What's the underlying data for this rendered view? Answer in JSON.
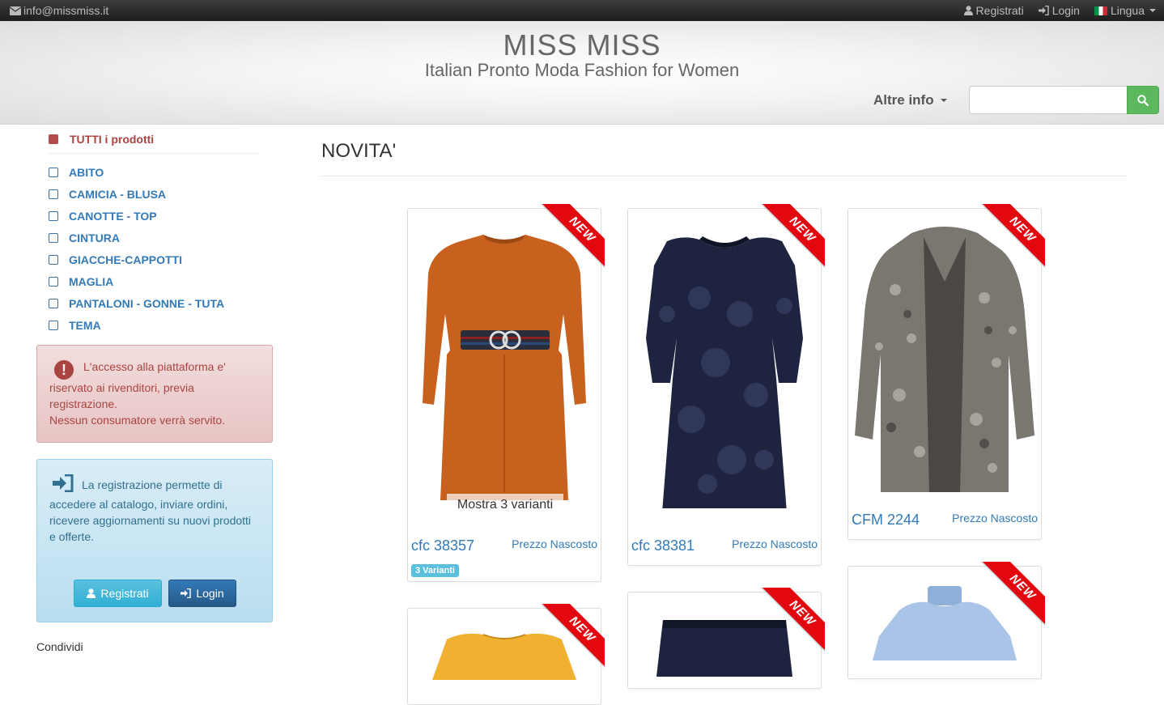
{
  "topbar": {
    "email": "info@missmiss.it",
    "register": "Registrati",
    "login": "Login",
    "language": "Lingua"
  },
  "header": {
    "brand": "MISS MISS",
    "tagline": "Italian Pronto Moda Fashion for Women",
    "more_info": "Altre info",
    "search_placeholder": ""
  },
  "sidebar": {
    "all_products": "TUTTI i prodotti",
    "categories": [
      "ABITO",
      "CAMICIA - BLUSA",
      "CANOTTE - TOP",
      "CINTURA",
      "GIACCHE-CAPPOTTI",
      "MAGLIA",
      "PANTALONI - GONNE - TUTA",
      "TEMA"
    ],
    "alert_danger": {
      "line1": "L'accesso alla piattaforma e' riservato ai rivenditori, previa registrazione.",
      "line2": "Nessun consumatore verrà servito."
    },
    "alert_info": {
      "text": "La registrazione permette di accedere al catalogo, inviare ordini, ricevere aggiornamenti su nuovi prodotti e offerte.",
      "register_button": "Registrati",
      "login_button": "Login"
    },
    "share": "Condividi"
  },
  "main": {
    "title": "NOVITA'",
    "ribbon_label": "NEW",
    "products": [
      {
        "code": "cfc 38357",
        "price": "Prezzo Nascosto",
        "variants_overlay": "Mostra 3 varianti",
        "variants_badge": "3 Varianti",
        "color": "#c8601e"
      },
      {
        "code": "cfc 38381",
        "price": "Prezzo Nascosto",
        "color": "#1e2440"
      },
      {
        "code": "CFM 2244",
        "price": "Prezzo Nascosto",
        "color": "#7a7670"
      },
      {
        "code": "",
        "price": "",
        "color": "#f0b030"
      },
      {
        "code": "",
        "price": "",
        "color": "#1e2440"
      },
      {
        "code": "",
        "price": "",
        "color": "#a9c4e6"
      }
    ]
  },
  "colors": {
    "accent": "#337ab7",
    "danger": "#a94442",
    "ribbon": "#e3070f",
    "search_button": "#5cb85c"
  }
}
